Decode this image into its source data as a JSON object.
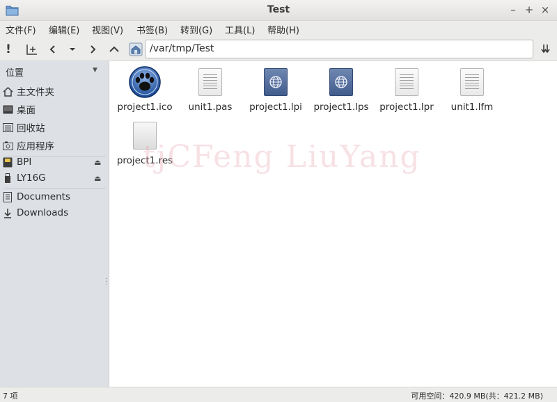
{
  "window": {
    "title": "Test"
  },
  "menu": [
    "文件(F)",
    "编辑(E)",
    "视图(V)",
    "书签(B)",
    "转到(G)",
    "工具(L)",
    "帮助(H)"
  ],
  "location": {
    "path": "/var/tmp/Test"
  },
  "sidebar": {
    "header": "位置",
    "items": [
      {
        "label": "主文件夹",
        "icon": "home-icon"
      },
      {
        "label": "桌面",
        "icon": "desktop-icon"
      },
      {
        "label": "回收站",
        "icon": "trash-icon"
      },
      {
        "label": "应用程序",
        "icon": "applications-icon"
      },
      {
        "label": "BPI",
        "icon": "sdcard-icon"
      },
      {
        "label": "LY16G",
        "icon": "usb-drive-icon"
      },
      {
        "label": "Documents",
        "icon": "documents-icon"
      },
      {
        "label": "Downloads",
        "icon": "downloads-icon"
      }
    ]
  },
  "files": [
    {
      "name": "project1.ico",
      "icon": "paw-icon"
    },
    {
      "name": "unit1.pas",
      "icon": "text-file-icon"
    },
    {
      "name": "project1.lpi",
      "icon": "globe-file-icon"
    },
    {
      "name": "project1.lps",
      "icon": "globe-file-icon"
    },
    {
      "name": "project1.lpr",
      "icon": "text-file-icon"
    },
    {
      "name": "unit1.lfm",
      "icon": "text-file-icon"
    },
    {
      "name": "project1.res",
      "icon": "blank-file-icon"
    }
  ],
  "watermark": "tjCFeng LiuYang",
  "status": {
    "item_count": "7 项",
    "free_space": "可用空间：420.9 MB(共：421.2 MB)"
  },
  "colors": {
    "sidebar_bg": "#dde1e6",
    "globe_icon": "#4a6393"
  }
}
